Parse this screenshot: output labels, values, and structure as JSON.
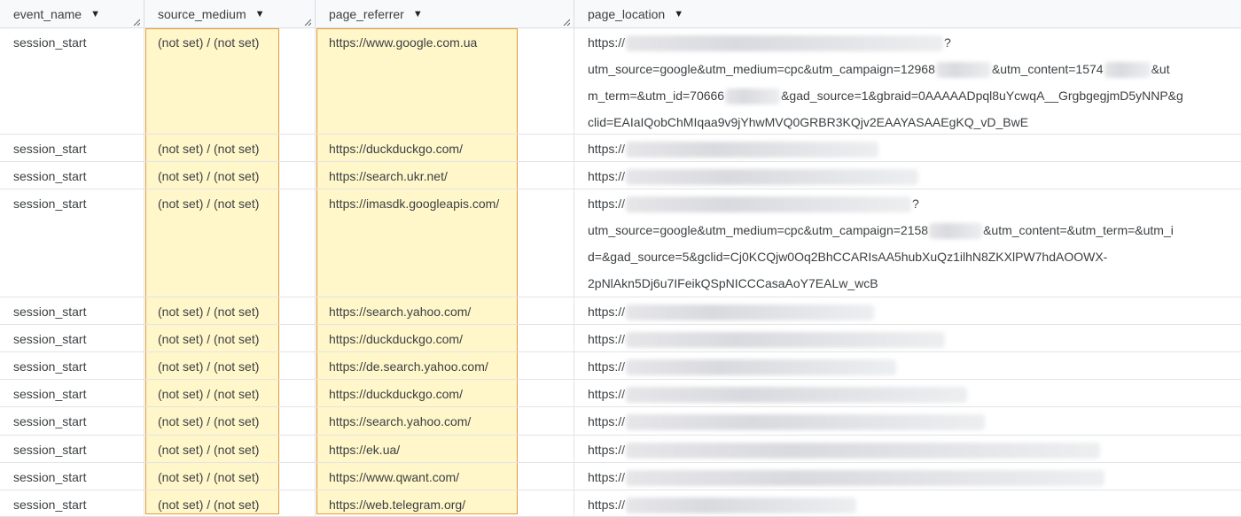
{
  "columns": [
    {
      "name": "event_name"
    },
    {
      "name": "source_medium"
    },
    {
      "name": "page_referrer"
    },
    {
      "name": "page_location"
    }
  ],
  "rows": [
    {
      "event_name": "session_start",
      "source_medium": "(not set) / (not set)",
      "page_referrer": "https://www.google.com.ua",
      "page_location_lines": [
        "https://[redacted]?",
        "utm_source=google&utm_medium=cpc&utm_campaign=12968[redacted]&utm_content=1574[redacted]&ut",
        "m_term=&utm_id=70666[redacted]&gad_source=1&gbraid=0AAAAADpql8uYcwqA__GrgbgegjmD5yNNP&g",
        "clid=EAIaIQobChMIqaa9v9jYhwMVQ0GRBR3KQjv2EAAYASAAEgKQ_vD_BwE"
      ]
    },
    {
      "event_name": "session_start",
      "source_medium": "(not set) / (not set)",
      "page_referrer": "https://duckduckgo.com/",
      "page_location_lines": [
        "https://[redacted]"
      ]
    },
    {
      "event_name": "session_start",
      "source_medium": "(not set) / (not set)",
      "page_referrer": "https://search.ukr.net/",
      "page_location_lines": [
        "https://[redacted]"
      ]
    },
    {
      "event_name": "session_start",
      "source_medium": "(not set) / (not set)",
      "page_referrer": "https://imasdk.googleapis.com/",
      "page_location_lines": [
        "https://[redacted]?",
        "utm_source=google&utm_medium=cpc&utm_campaign=2158[redacted]&utm_content=&utm_term=&utm_i",
        "d=&gad_source=5&gclid=Cj0KCQjw0Oq2BhCCARIsAA5hubXuQz1ilhN8ZKXlPW7hdAOOWX-",
        "2pNlAkn5Dj6u7IFeikQSpNICCCasaAoY7EALw_wcB"
      ]
    },
    {
      "event_name": "session_start",
      "source_medium": "(not set) / (not set)",
      "page_referrer": "https://search.yahoo.com/",
      "page_location_lines": [
        "https://[redacted]"
      ]
    },
    {
      "event_name": "session_start",
      "source_medium": "(not set) / (not set)",
      "page_referrer": "https://duckduckgo.com/",
      "page_location_lines": [
        "https://[redacted]"
      ]
    },
    {
      "event_name": "session_start",
      "source_medium": "(not set) / (not set)",
      "page_referrer": "https://de.search.yahoo.com/",
      "page_location_lines": [
        "https://[redacted]"
      ]
    },
    {
      "event_name": "session_start",
      "source_medium": "(not set) / (not set)",
      "page_referrer": "https://duckduckgo.com/",
      "page_location_lines": [
        "https://[redacted]"
      ]
    },
    {
      "event_name": "session_start",
      "source_medium": "(not set) / (not set)",
      "page_referrer": "https://search.yahoo.com/",
      "page_location_lines": [
        "https://[redacted]"
      ]
    },
    {
      "event_name": "session_start",
      "source_medium": "(not set) / (not set)",
      "page_referrer": "https://ek.ua/",
      "page_location_lines": [
        "https://[redacted]"
      ]
    },
    {
      "event_name": "session_start",
      "source_medium": "(not set) / (not set)",
      "page_referrer": "https://www.qwant.com/",
      "page_location_lines": [
        "https://[redacted]"
      ]
    },
    {
      "event_name": "session_start",
      "source_medium": "(not set) / (not set)",
      "page_referrer": "https://web.telegram.org/",
      "page_location_lines": [
        "https://[redacted]"
      ]
    }
  ],
  "colors": {
    "header_bg": "#f8f9fa",
    "highlight_fill": "#fff7c9",
    "highlight_border": "#e19b3c",
    "grid_line": "#e3e3e3"
  },
  "icons": {
    "sort_arrow": "sort-dropdown-icon",
    "resize_grip": "resize-grip-icon"
  }
}
